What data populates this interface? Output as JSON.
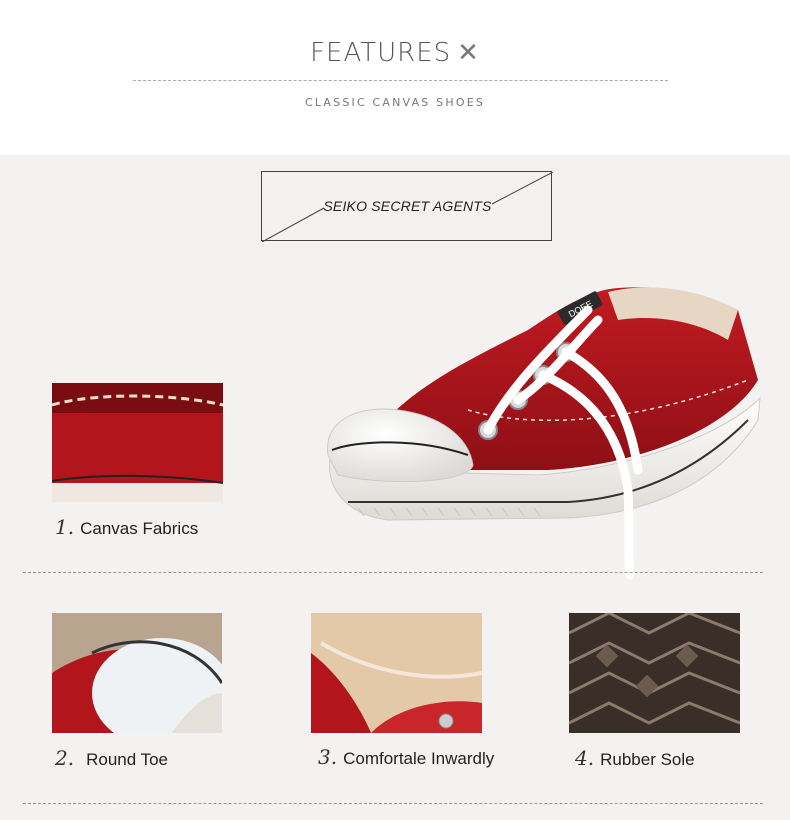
{
  "header": {
    "title": "FEATURES",
    "title_mark": "✕",
    "subtitle": "CLASSIC CANVAS SHOES"
  },
  "badge": {
    "label": "SEIKO SECRET AGENTS"
  },
  "product": {
    "tongue_tag": "DOEE"
  },
  "features": [
    {
      "num": "1.",
      "label": "Canvas Fabrics",
      "image_icon": "canvas-fabric-closeup"
    },
    {
      "num": "2.",
      "label": "Round Toe",
      "image_icon": "round-toe-closeup"
    },
    {
      "num": "3.",
      "label": "Comfortale Inwardly",
      "image_icon": "inner-lining-closeup"
    },
    {
      "num": "4.",
      "label": "Rubber Sole",
      "image_icon": "rubber-sole-closeup"
    }
  ],
  "colors": {
    "accent_red": "#a8131b",
    "panel_bg": "#f3f2f1"
  }
}
